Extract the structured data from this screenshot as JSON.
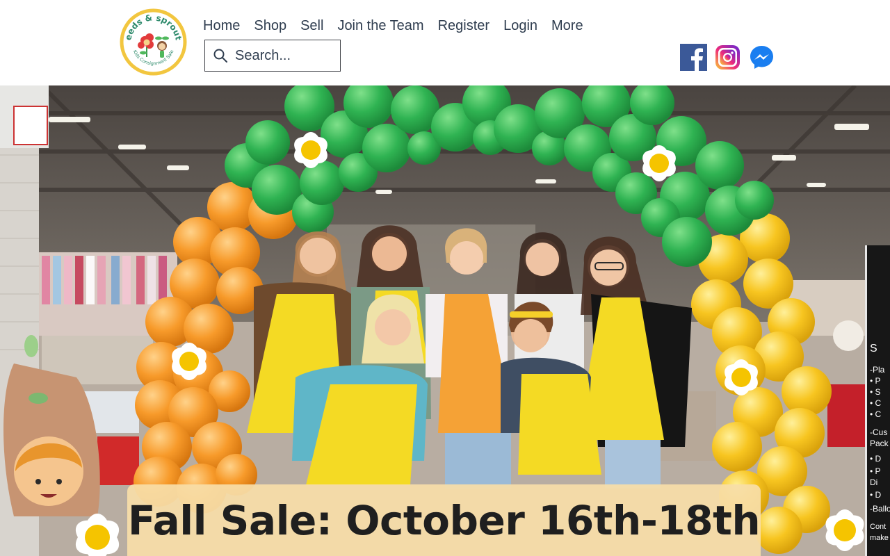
{
  "header": {
    "logo": {
      "icon": "seeds-and-sprouts-logo-icon",
      "wordmark": "seeds & sprouts",
      "tagline": "Kids Consignment Sale",
      "colors": {
        "ring": "#f2c63f",
        "text": "#2d8a6b"
      }
    },
    "nav": [
      {
        "label": "Home"
      },
      {
        "label": "Shop"
      },
      {
        "label": "Sell"
      },
      {
        "label": "Join the Team"
      },
      {
        "label": "Register"
      },
      {
        "label": "Login"
      },
      {
        "label": "More"
      }
    ],
    "search": {
      "placeholder": "Search...",
      "value": "",
      "icon": "search-icon"
    },
    "social": [
      {
        "icon": "facebook-icon",
        "color": "#3b5998"
      },
      {
        "icon": "instagram-icon",
        "color": "#c13584"
      },
      {
        "icon": "messenger-icon",
        "color": "#1a7ef0"
      }
    ]
  },
  "hero": {
    "image": "team-photo-under-balloon-arch",
    "colors": {
      "green_balloon": "#2fb352",
      "orange_balloon": "#f79a2a",
      "yellow_balloon": "#f7c520"
    },
    "banner": {
      "title": "Fall Sale: October 16th-18th",
      "background": "#f7dea8"
    },
    "side_sign": [
      "S",
      "-Pla",
      "• P",
      "• S",
      "• C",
      "• C",
      "-Cus",
      "Pack",
      "• D",
      "• P",
      "Di",
      "• D",
      "-Ballo",
      "Cont",
      "make"
    ]
  }
}
